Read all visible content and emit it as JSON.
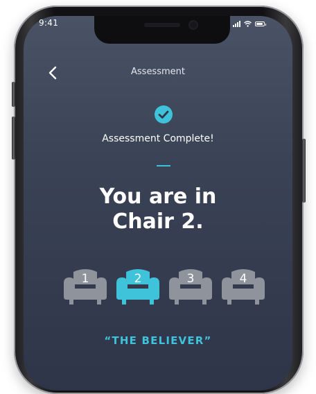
{
  "status_bar": {
    "time": "9:41"
  },
  "header": {
    "title": "Assessment"
  },
  "main": {
    "complete_message": "Assessment Complete!",
    "headline_line1": "You are in",
    "headline_line2": "Chair 2.",
    "chairs": [
      {
        "number": "1",
        "selected": false
      },
      {
        "number": "2",
        "selected": true
      },
      {
        "number": "3",
        "selected": false
      },
      {
        "number": "4",
        "selected": false
      }
    ],
    "tagline": "“THE BELIEVER”"
  },
  "colors": {
    "accent": "#3fc3da",
    "chair_inactive": "#8e939c",
    "background_top": "#4a5266",
    "background_bottom": "#2f3549"
  }
}
